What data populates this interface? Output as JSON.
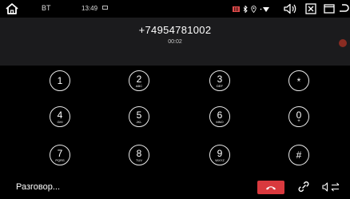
{
  "statusbar": {
    "bt_label": "BT",
    "time": "13:49"
  },
  "call": {
    "number": "+74954781002",
    "duration": "00:02"
  },
  "keypad": [
    {
      "digit": "1",
      "letters": ""
    },
    {
      "digit": "2",
      "letters": "ABC"
    },
    {
      "digit": "3",
      "letters": "DEF"
    },
    {
      "digit": "*",
      "letters": ""
    },
    {
      "digit": "4",
      "letters": "GHI"
    },
    {
      "digit": "5",
      "letters": "JKL"
    },
    {
      "digit": "6",
      "letters": "MNO"
    },
    {
      "digit": "0",
      "letters": "+"
    },
    {
      "digit": "7",
      "letters": "PQRS"
    },
    {
      "digit": "8",
      "letters": "TUV"
    },
    {
      "digit": "9",
      "letters": "WXYZ"
    },
    {
      "digit": "#",
      "letters": ""
    }
  ],
  "bottom": {
    "talk_label": "Разговор..."
  },
  "colors": {
    "end_call": "#d9393e",
    "header_bg": "#1b1b1d",
    "battery_red": "#e24c4c"
  },
  "icons": {
    "home": "home-icon",
    "clock": "clock-icon",
    "battery": "battery-icon",
    "bluetooth": "bluetooth-icon",
    "location": "location-icon",
    "wifi": "wifi-icon",
    "volume": "volume-icon",
    "close": "close-icon",
    "window": "recent-apps-icon",
    "back": "back-icon",
    "end_call": "phone-hangup-icon",
    "link": "link-icon",
    "audio_switch": "audio-switch-icon"
  }
}
